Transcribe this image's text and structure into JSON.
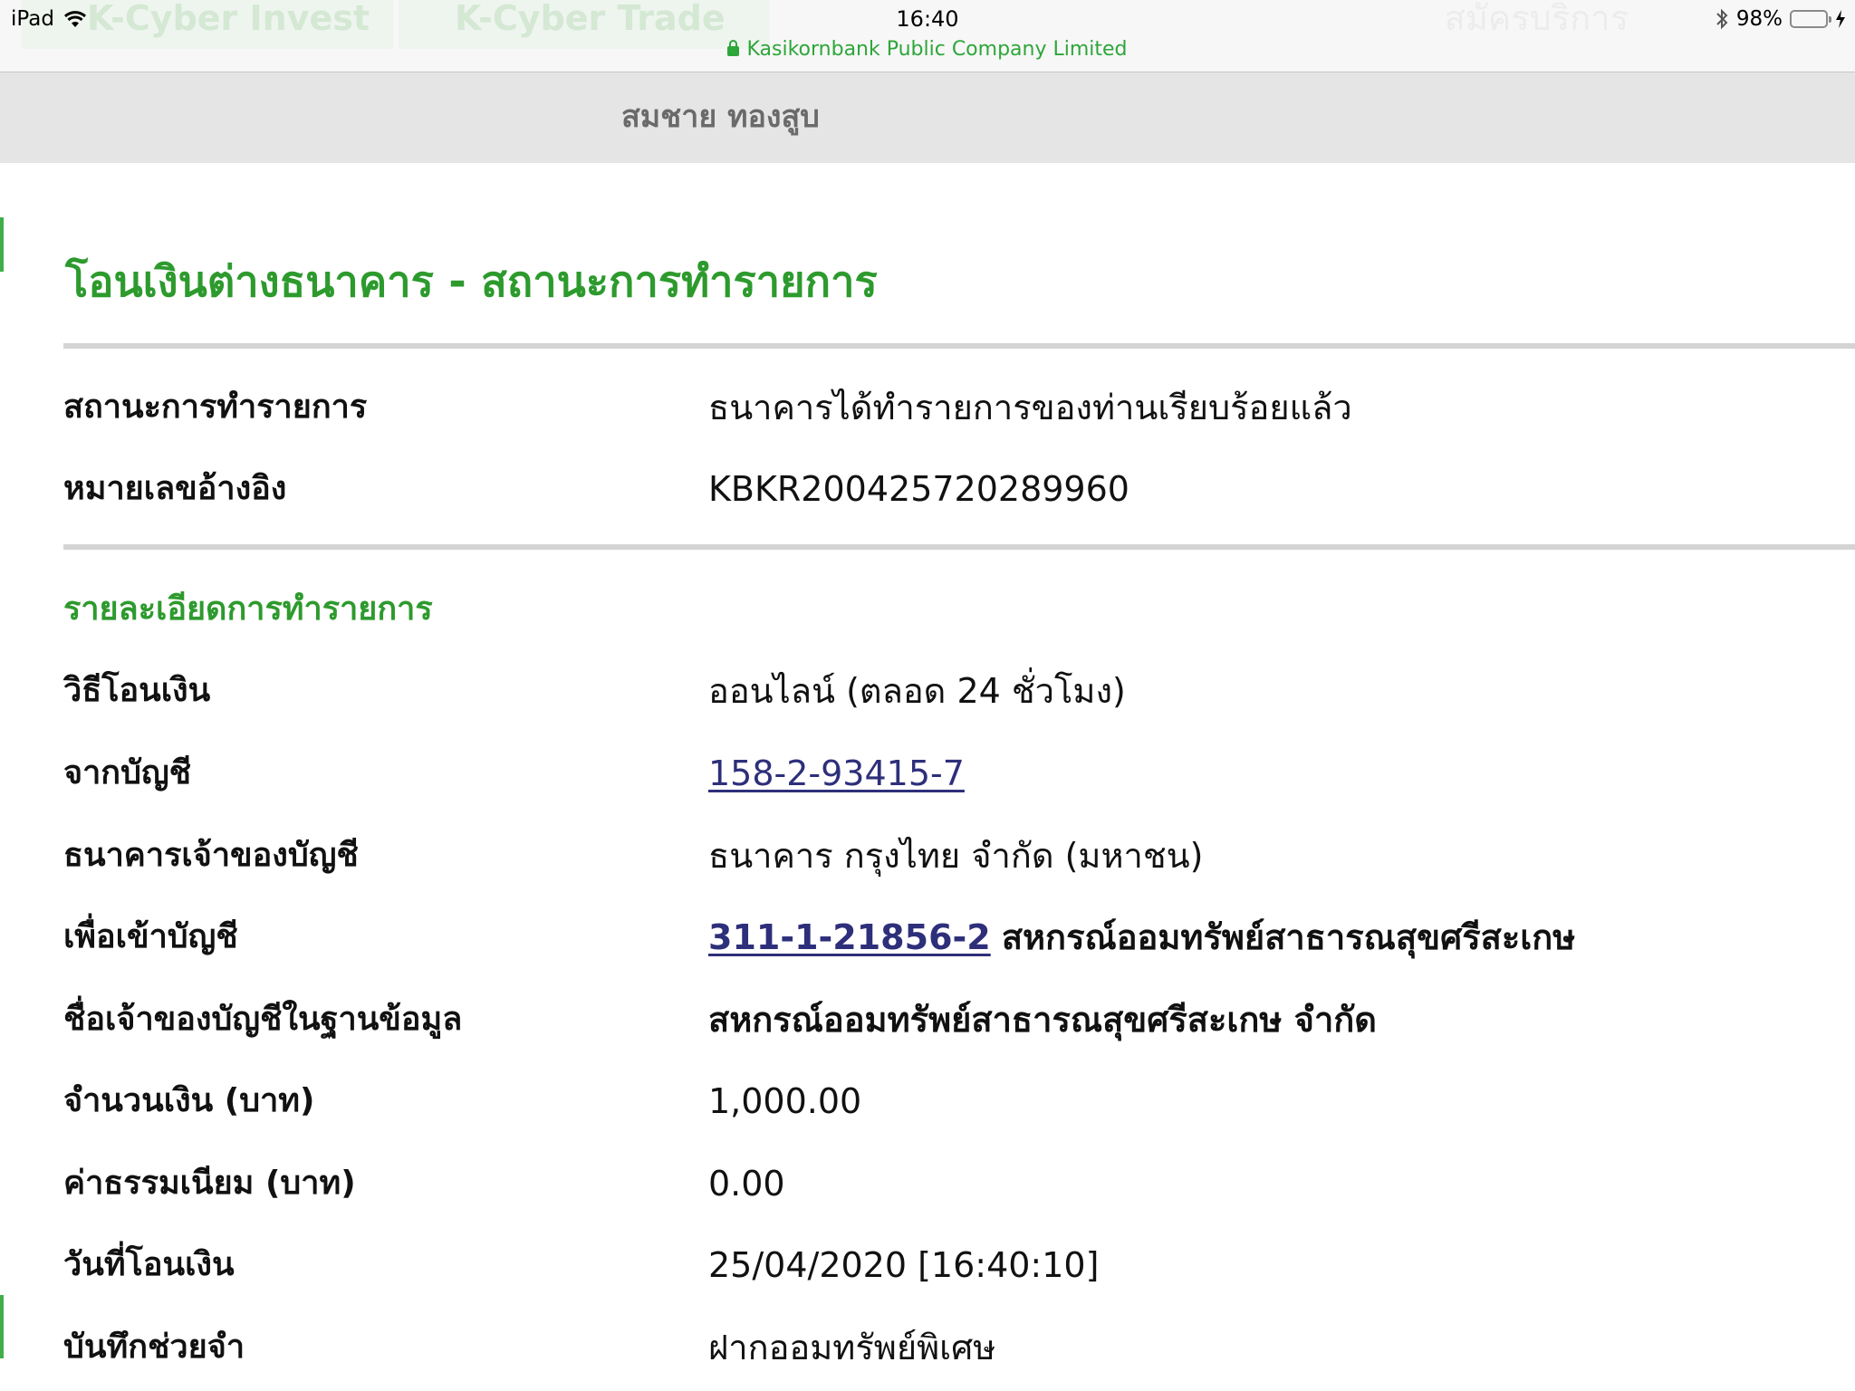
{
  "status_bar": {
    "device": "iPad",
    "time": "16:40",
    "url_label": "Kasikornbank Public Company Limited",
    "battery": "98%",
    "battery_level": 0.98,
    "background_tabs": [
      "K-Cyber Invest",
      "K-Cyber Trade"
    ],
    "background_right": "สมัครบริการ"
  },
  "header": {
    "user_name": "สมชาย ทองสูบ"
  },
  "page": {
    "title": "โอนเงินต่างธนาคาร - สถานะการทำรายการ"
  },
  "summary": {
    "status_label": "สถานะการทำรายการ",
    "status_value": "ธนาคารได้ทำรายการของท่านเรียบร้อยแล้ว",
    "reference_label": "หมายเลขอ้างอิง",
    "reference_value": "KBKR200425720289960"
  },
  "details": {
    "section_title": "รายละเอียดการทำรายการ",
    "method_label": "วิธีโอนเงิน",
    "method_value": "ออนไลน์ (ตลอด 24 ชั่วโมง)",
    "from_label": "จากบัญชี",
    "from_value": "158-2-93415-7",
    "bank_label": "ธนาคารเจ้าของบัญชี",
    "bank_value": "ธนาคาร กรุงไทย จำกัด (มหาชน)",
    "to_label": "เพื่อเข้าบัญชี",
    "to_account": "311-1-21856-2",
    "to_name": "สหกรณ์ออมทรัพย์สาธารณสุขศรีสะเกษ",
    "db_owner_label": "ชื่อเจ้าของบัญชีในฐานข้อมูล",
    "db_owner_value": "สหกรณ์ออมทรัพย์สาธารณสุขศรีสะเกษ จำกัด",
    "amount_label": "จำนวนเงิน (บาท)",
    "amount_value": "1,000.00",
    "fee_label": "ค่าธรรมเนียม (บาท)",
    "fee_value": "0.00",
    "date_label": "วันที่โอนเงิน",
    "date_value": "25/04/2020 [16:40:10]",
    "memo_label": "บันทึกช่วยจำ",
    "memo_value": "ฝากออมทรัพย์พิเศษ"
  },
  "colors": {
    "brand_green": "#2d9a2d",
    "link": "#2e2f7a",
    "header_bg": "#e5e5e5"
  }
}
